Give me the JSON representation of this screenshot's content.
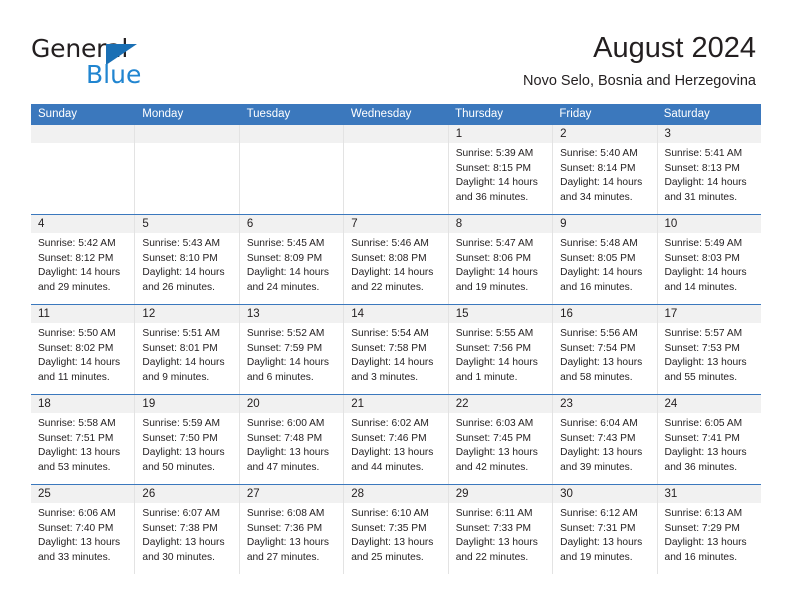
{
  "brand": {
    "name_top": "General",
    "name_bottom": "Blue",
    "triangle_color": "#1a6fb4",
    "blue_color": "#2185d0"
  },
  "header": {
    "title": "August 2024",
    "subtitle": "Novo Selo, Bosnia and Herzegovina",
    "accent_color": "#3b78bd"
  },
  "calendar": {
    "weekday_headers": [
      "Sunday",
      "Monday",
      "Tuesday",
      "Wednesday",
      "Thursday",
      "Friday",
      "Saturday"
    ],
    "weeks": [
      [
        {
          "day": "",
          "empty": true,
          "sunrise": "",
          "sunset": "",
          "daylight_1": "",
          "daylight_2": ""
        },
        {
          "day": "",
          "empty": true,
          "sunrise": "",
          "sunset": "",
          "daylight_1": "",
          "daylight_2": ""
        },
        {
          "day": "",
          "empty": true,
          "sunrise": "",
          "sunset": "",
          "daylight_1": "",
          "daylight_2": ""
        },
        {
          "day": "",
          "empty": true,
          "sunrise": "",
          "sunset": "",
          "daylight_1": "",
          "daylight_2": ""
        },
        {
          "day": "1",
          "sunrise": "Sunrise: 5:39 AM",
          "sunset": "Sunset: 8:15 PM",
          "daylight_1": "Daylight: 14 hours",
          "daylight_2": "and 36 minutes."
        },
        {
          "day": "2",
          "sunrise": "Sunrise: 5:40 AM",
          "sunset": "Sunset: 8:14 PM",
          "daylight_1": "Daylight: 14 hours",
          "daylight_2": "and 34 minutes."
        },
        {
          "day": "3",
          "sunrise": "Sunrise: 5:41 AM",
          "sunset": "Sunset: 8:13 PM",
          "daylight_1": "Daylight: 14 hours",
          "daylight_2": "and 31 minutes."
        }
      ],
      [
        {
          "day": "4",
          "sunrise": "Sunrise: 5:42 AM",
          "sunset": "Sunset: 8:12 PM",
          "daylight_1": "Daylight: 14 hours",
          "daylight_2": "and 29 minutes."
        },
        {
          "day": "5",
          "sunrise": "Sunrise: 5:43 AM",
          "sunset": "Sunset: 8:10 PM",
          "daylight_1": "Daylight: 14 hours",
          "daylight_2": "and 26 minutes."
        },
        {
          "day": "6",
          "sunrise": "Sunrise: 5:45 AM",
          "sunset": "Sunset: 8:09 PM",
          "daylight_1": "Daylight: 14 hours",
          "daylight_2": "and 24 minutes."
        },
        {
          "day": "7",
          "sunrise": "Sunrise: 5:46 AM",
          "sunset": "Sunset: 8:08 PM",
          "daylight_1": "Daylight: 14 hours",
          "daylight_2": "and 22 minutes."
        },
        {
          "day": "8",
          "sunrise": "Sunrise: 5:47 AM",
          "sunset": "Sunset: 8:06 PM",
          "daylight_1": "Daylight: 14 hours",
          "daylight_2": "and 19 minutes."
        },
        {
          "day": "9",
          "sunrise": "Sunrise: 5:48 AM",
          "sunset": "Sunset: 8:05 PM",
          "daylight_1": "Daylight: 14 hours",
          "daylight_2": "and 16 minutes."
        },
        {
          "day": "10",
          "sunrise": "Sunrise: 5:49 AM",
          "sunset": "Sunset: 8:03 PM",
          "daylight_1": "Daylight: 14 hours",
          "daylight_2": "and 14 minutes."
        }
      ],
      [
        {
          "day": "11",
          "sunrise": "Sunrise: 5:50 AM",
          "sunset": "Sunset: 8:02 PM",
          "daylight_1": "Daylight: 14 hours",
          "daylight_2": "and 11 minutes."
        },
        {
          "day": "12",
          "sunrise": "Sunrise: 5:51 AM",
          "sunset": "Sunset: 8:01 PM",
          "daylight_1": "Daylight: 14 hours",
          "daylight_2": "and 9 minutes."
        },
        {
          "day": "13",
          "sunrise": "Sunrise: 5:52 AM",
          "sunset": "Sunset: 7:59 PM",
          "daylight_1": "Daylight: 14 hours",
          "daylight_2": "and 6 minutes."
        },
        {
          "day": "14",
          "sunrise": "Sunrise: 5:54 AM",
          "sunset": "Sunset: 7:58 PM",
          "daylight_1": "Daylight: 14 hours",
          "daylight_2": "and 3 minutes."
        },
        {
          "day": "15",
          "sunrise": "Sunrise: 5:55 AM",
          "sunset": "Sunset: 7:56 PM",
          "daylight_1": "Daylight: 14 hours",
          "daylight_2": "and 1 minute."
        },
        {
          "day": "16",
          "sunrise": "Sunrise: 5:56 AM",
          "sunset": "Sunset: 7:54 PM",
          "daylight_1": "Daylight: 13 hours",
          "daylight_2": "and 58 minutes."
        },
        {
          "day": "17",
          "sunrise": "Sunrise: 5:57 AM",
          "sunset": "Sunset: 7:53 PM",
          "daylight_1": "Daylight: 13 hours",
          "daylight_2": "and 55 minutes."
        }
      ],
      [
        {
          "day": "18",
          "sunrise": "Sunrise: 5:58 AM",
          "sunset": "Sunset: 7:51 PM",
          "daylight_1": "Daylight: 13 hours",
          "daylight_2": "and 53 minutes."
        },
        {
          "day": "19",
          "sunrise": "Sunrise: 5:59 AM",
          "sunset": "Sunset: 7:50 PM",
          "daylight_1": "Daylight: 13 hours",
          "daylight_2": "and 50 minutes."
        },
        {
          "day": "20",
          "sunrise": "Sunrise: 6:00 AM",
          "sunset": "Sunset: 7:48 PM",
          "daylight_1": "Daylight: 13 hours",
          "daylight_2": "and 47 minutes."
        },
        {
          "day": "21",
          "sunrise": "Sunrise: 6:02 AM",
          "sunset": "Sunset: 7:46 PM",
          "daylight_1": "Daylight: 13 hours",
          "daylight_2": "and 44 minutes."
        },
        {
          "day": "22",
          "sunrise": "Sunrise: 6:03 AM",
          "sunset": "Sunset: 7:45 PM",
          "daylight_1": "Daylight: 13 hours",
          "daylight_2": "and 42 minutes."
        },
        {
          "day": "23",
          "sunrise": "Sunrise: 6:04 AM",
          "sunset": "Sunset: 7:43 PM",
          "daylight_1": "Daylight: 13 hours",
          "daylight_2": "and 39 minutes."
        },
        {
          "day": "24",
          "sunrise": "Sunrise: 6:05 AM",
          "sunset": "Sunset: 7:41 PM",
          "daylight_1": "Daylight: 13 hours",
          "daylight_2": "and 36 minutes."
        }
      ],
      [
        {
          "day": "25",
          "sunrise": "Sunrise: 6:06 AM",
          "sunset": "Sunset: 7:40 PM",
          "daylight_1": "Daylight: 13 hours",
          "daylight_2": "and 33 minutes."
        },
        {
          "day": "26",
          "sunrise": "Sunrise: 6:07 AM",
          "sunset": "Sunset: 7:38 PM",
          "daylight_1": "Daylight: 13 hours",
          "daylight_2": "and 30 minutes."
        },
        {
          "day": "27",
          "sunrise": "Sunrise: 6:08 AM",
          "sunset": "Sunset: 7:36 PM",
          "daylight_1": "Daylight: 13 hours",
          "daylight_2": "and 27 minutes."
        },
        {
          "day": "28",
          "sunrise": "Sunrise: 6:10 AM",
          "sunset": "Sunset: 7:35 PM",
          "daylight_1": "Daylight: 13 hours",
          "daylight_2": "and 25 minutes."
        },
        {
          "day": "29",
          "sunrise": "Sunrise: 6:11 AM",
          "sunset": "Sunset: 7:33 PM",
          "daylight_1": "Daylight: 13 hours",
          "daylight_2": "and 22 minutes."
        },
        {
          "day": "30",
          "sunrise": "Sunrise: 6:12 AM",
          "sunset": "Sunset: 7:31 PM",
          "daylight_1": "Daylight: 13 hours",
          "daylight_2": "and 19 minutes."
        },
        {
          "day": "31",
          "sunrise": "Sunrise: 6:13 AM",
          "sunset": "Sunset: 7:29 PM",
          "daylight_1": "Daylight: 13 hours",
          "daylight_2": "and 16 minutes."
        }
      ]
    ]
  }
}
